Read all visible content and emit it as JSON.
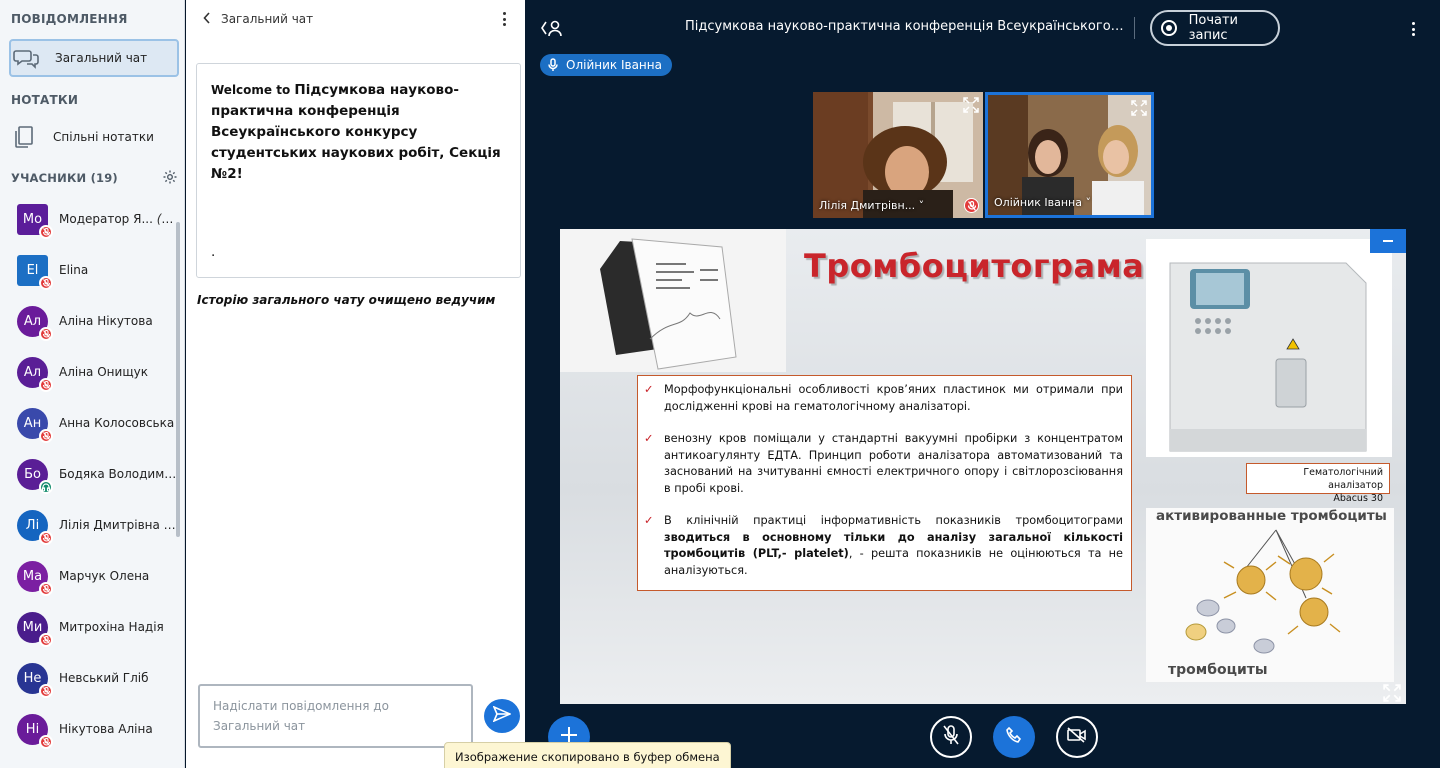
{
  "user_panel": {
    "messages_title": "ПОВІДОМЛЕННЯ",
    "public_chat_label": "Загальний чат",
    "notes_title": "НОТАТКИ",
    "shared_notes_label": "Спільні нотатки",
    "users_title": "УЧАСНИКИ (19)",
    "users": [
      {
        "initials": "Мо",
        "name": "Модератор Я...",
        "you": "(Ви)",
        "color": "#5b1d9a",
        "square": true,
        "status": "muted"
      },
      {
        "initials": "El",
        "name": "Elina",
        "you": "",
        "color": "#1c6fc4",
        "square": true,
        "status": "muted"
      },
      {
        "initials": "Ал",
        "name": "Аліна Нікутова",
        "you": "",
        "color": "#6a1b9a",
        "square": false,
        "status": "muted"
      },
      {
        "initials": "Ал",
        "name": "Аліна Онищук",
        "you": "",
        "color": "#5a1e96",
        "square": false,
        "status": "muted"
      },
      {
        "initials": "Ан",
        "name": "Анна Колосовська",
        "you": "",
        "color": "#3949ab",
        "square": false,
        "status": "muted"
      },
      {
        "initials": "Бо",
        "name": "Бодяка Володими...",
        "you": "",
        "color": "#5a1e96",
        "square": false,
        "status": "listen"
      },
      {
        "initials": "Лі",
        "name": "Лілія Дмитрівна Т...",
        "you": "",
        "color": "#1565c0",
        "square": false,
        "status": "muted"
      },
      {
        "initials": "Ма",
        "name": "Марчук Олена",
        "you": "",
        "color": "#7b1fa2",
        "square": false,
        "status": "muted"
      },
      {
        "initials": "Ми",
        "name": "Митрохіна Надія",
        "you": "",
        "color": "#4a1d8c",
        "square": false,
        "status": "muted"
      },
      {
        "initials": "Не",
        "name": "Невський Гліб",
        "you": "",
        "color": "#283593",
        "square": false,
        "status": "muted"
      },
      {
        "initials": "Ні",
        "name": "Нікутова Аліна",
        "you": "",
        "color": "#6a1b9a",
        "square": false,
        "status": "muted"
      }
    ]
  },
  "chat": {
    "header": "Загальний чат",
    "welcome_lead": "Welcome to ",
    "welcome_name": "Підсумкова науково-практична конференція Всеукраїнського конкурсу студентських наукових робіт, Секція №2!",
    "welcome_dot": ".",
    "cleared_notice": "Історію загального чату очищено ведучим",
    "input_placeholder": "Надіслати повідомлення до Загальний чат"
  },
  "topbar": {
    "title": "Підсумкова науково-практична конференція Всеукраїнського кон...",
    "record_label": "Почати запис"
  },
  "talking_indicator": "Олійник Іванна",
  "videos": [
    {
      "name": "Лілія Дмитрівн..."
    },
    {
      "name": "Олійник Іванна"
    }
  ],
  "slide": {
    "title": "Тромбоцитограма",
    "bullets": [
      {
        "text": "Морфофункціональні особливості кров’яних пластинок ми отримали  при дослідженні крові на гематологічному аналізаторі."
      },
      {
        "text": "венозну кров поміщали у стандартні вакуумні пробірки з концентратом антикоагулянту ЕДТА. Принцип роботи аналізатора автоматизований та заснований на зчитуванні ємності електричного опору і світлорозсіювання в пробі крові."
      },
      {
        "text_before": "В клінічній практиці інформативність показників тромбоцитограми ",
        "bold": "зводиться в основному тільки до аналізу загальної кількості тромбоцитів (PLT,- platelet)",
        "text_after": ", - решта показників не оцінюються та не аналізуються."
      }
    ],
    "caption_line1": "Гематологічний аналізатор",
    "caption_line2": "Abacus 30",
    "image_label_top": "активированные тромбоциты",
    "image_label_bottom": "тромбоциты"
  },
  "toast": "Изображение скопировано в буфер обмена",
  "colors": {
    "accent": "#1c73d9",
    "main_bg": "#061a2f",
    "slide_title": "#c9252b",
    "muted_badge": "#e23b3b"
  }
}
